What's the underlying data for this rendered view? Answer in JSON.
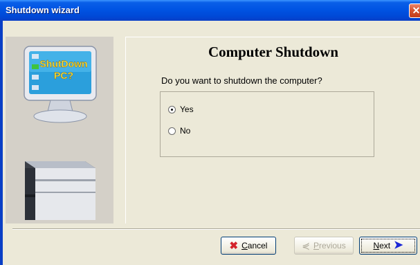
{
  "window": {
    "title": "Shutdown wizard",
    "close_icon": "close-icon"
  },
  "left_panel": {
    "monitor_text_line1": "ShutDown",
    "monitor_text_line2": "PC?",
    "monitor_icon": "monitor-icon",
    "computer_icon": "computer-case-icon"
  },
  "content": {
    "heading": "Computer Shutdown",
    "question": "Do you want to shutdown the computer?",
    "options": [
      {
        "label": "Yes",
        "checked": true
      },
      {
        "label": "No",
        "checked": false
      }
    ]
  },
  "buttons": {
    "cancel": "Cancel",
    "previous": "Previous",
    "next": "Next"
  },
  "colors": {
    "titlebar": "#0054e3",
    "window_bg": "#ece9d8",
    "cancel_icon": "#d4232b",
    "next_icon": "#1b27d6"
  }
}
